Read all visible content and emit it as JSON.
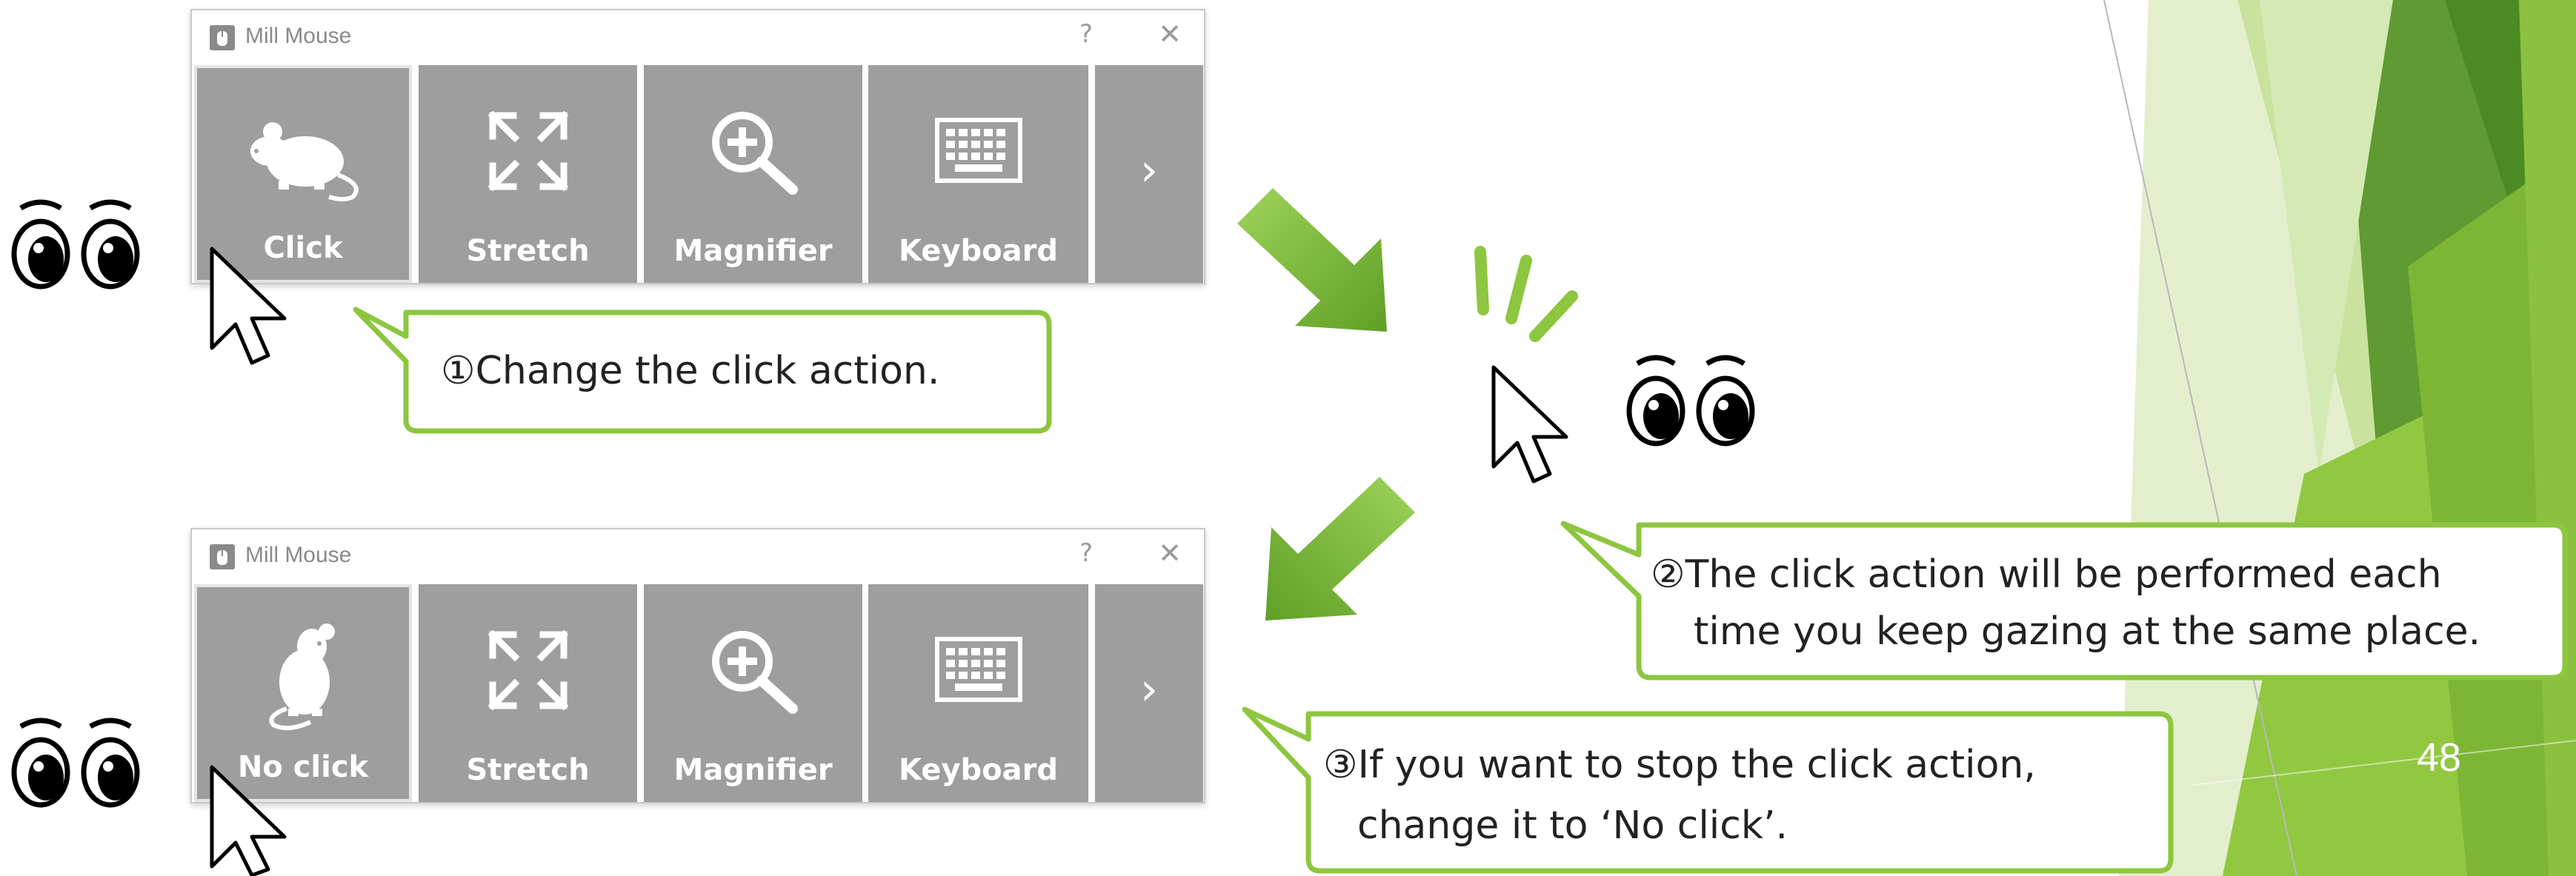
{
  "window_top": {
    "title": "Mill Mouse",
    "help": "?",
    "close": "✕",
    "tiles": [
      {
        "label": "Click",
        "icon": "mouse-icon",
        "selected": true
      },
      {
        "label": "Stretch",
        "icon": "stretch-arrows-icon"
      },
      {
        "label": "Magnifier",
        "icon": "magnifier-icon"
      },
      {
        "label": "Keyboard",
        "icon": "keyboard-icon"
      },
      {
        "label": "",
        "icon": "chevron-right-icon",
        "glyph": "›"
      }
    ]
  },
  "window_bottom": {
    "title": "Mill Mouse",
    "help": "?",
    "close": "✕",
    "tiles": [
      {
        "label": "No click",
        "icon": "mouse-no-click-icon",
        "selected": true
      },
      {
        "label": "Stretch",
        "icon": "stretch-arrows-icon"
      },
      {
        "label": "Magnifier",
        "icon": "magnifier-icon"
      },
      {
        "label": "Keyboard",
        "icon": "keyboard-icon"
      },
      {
        "label": "",
        "icon": "chevron-right-icon",
        "glyph": "›"
      }
    ]
  },
  "callouts": {
    "step1": "①Change the click action.",
    "step2_line1": "②The click action will be performed each",
    "step2_line2": "time you keep gazing at the same place.",
    "step3_line1": "③If you want to stop the click action,",
    "step3_line2": "change it to ‘No click’."
  },
  "page_number": "48",
  "colors": {
    "accent_green": "#7ab53a",
    "tile_gray": "#9e9e9e",
    "callout_border": "#8dc63f"
  }
}
